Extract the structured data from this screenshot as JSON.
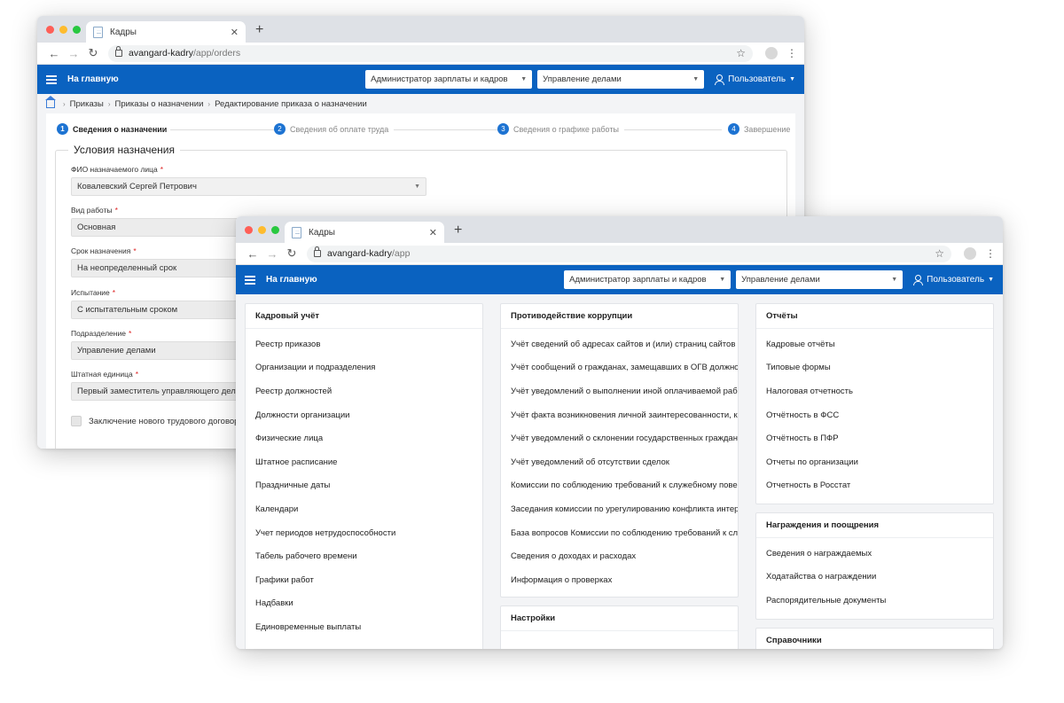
{
  "back_window": {
    "tab_title": "Кадры",
    "url_host": "avangard-kadry",
    "url_path": "/app/orders",
    "home_label": "На главную",
    "role_select": "Администратор зарплаты и кадров",
    "dept_select": "Управление делами",
    "user_label": "Пользователь",
    "breadcrumbs": [
      "Приказы",
      "Приказы о назначении",
      "Редактирование приказа о назначении"
    ],
    "steps": [
      {
        "num": "1",
        "label": "Сведения о назначении"
      },
      {
        "num": "2",
        "label": "Сведения об оплате труда"
      },
      {
        "num": "3",
        "label": "Сведения о графике работы"
      },
      {
        "num": "4",
        "label": "Завершение"
      }
    ],
    "section_title": "Условия назначения",
    "fields": [
      {
        "label": "ФИО назначаемого лица",
        "value": "Ковалевский Сергей Петрович"
      },
      {
        "label": "Вид работы",
        "value": "Основная"
      },
      {
        "label": "Срок назначения",
        "value": "На неопределенный срок"
      },
      {
        "label": "Испытание",
        "value": "С испытательным сроком"
      },
      {
        "label": "Подразделение",
        "value": "Управление делами"
      },
      {
        "label": "Штатная единица",
        "value": "Первый заместитель управляющего делами Пр"
      }
    ],
    "checkbox_label": "Заключение нового трудового договора (слу"
  },
  "front_window": {
    "tab_title": "Кадры",
    "url_host": "avangard-kadry",
    "url_path": "/app",
    "home_label": "На главную",
    "role_select": "Администратор зарплаты и кадров",
    "dept_select": "Управление делами",
    "user_label": "Пользователь",
    "cards": {
      "hr": {
        "title": "Кадровый учёт",
        "items": [
          "Реестр приказов",
          "Организации и подразделения",
          "Реестр должностей",
          "Должности организации",
          "Физические лица",
          "Штатное расписание",
          "Праздничные даты",
          "Календари",
          "Учет периодов нетрудоспособности",
          "Табель рабочего времени",
          "Графики работ",
          "Надбавки",
          "Единовременные выплаты"
        ]
      },
      "anticorruption": {
        "title": "Противодействие коррупции",
        "items": [
          "Учёт сведений об адресах сайтов и (или) страниц сайтов",
          "Учёт сообщений о гражданах, замещавших в ОГВ должнос...",
          "Учёт уведомлений о выполнении иной оплачиваемой рабо...",
          "Учёт факта возникновения личной заинтересованности, ко...",
          "Учёт уведомлений о склонении государственных граждан...",
          "Учёт уведомлений об отсутствии сделок",
          "Комиссии по соблюдению требований к служебному пове...",
          "Заседания комиссии по урегулированию конфликта интер...",
          "База вопросов Комиссии по соблюдению требований к сл...",
          "Сведения о доходах и расходах",
          "Информация о проверках"
        ]
      },
      "settings": {
        "title": "Настройки",
        "items": []
      },
      "reports": {
        "title": "Отчёты",
        "items": [
          "Кадровые отчёты",
          "Типовые формы",
          "Налоговая отчетность",
          "Отчётность в ФСС",
          "Отчётность в ПФР",
          "Отчеты по организации",
          "Отчетность в Росстат"
        ]
      },
      "awards": {
        "title": "Награждения и поощрения",
        "items": [
          "Сведения о награждаемых",
          "Ходатайства о награждении",
          "Распорядительные документы"
        ]
      },
      "directories": {
        "title": "Справочники",
        "items": []
      }
    }
  },
  "colors": {
    "appbar": "#0a62c0",
    "step_accent": "#1d73d2",
    "required": "#d22222",
    "mac_red": "#fe5f57",
    "mac_yellow": "#febc2e",
    "mac_green": "#28c840"
  }
}
